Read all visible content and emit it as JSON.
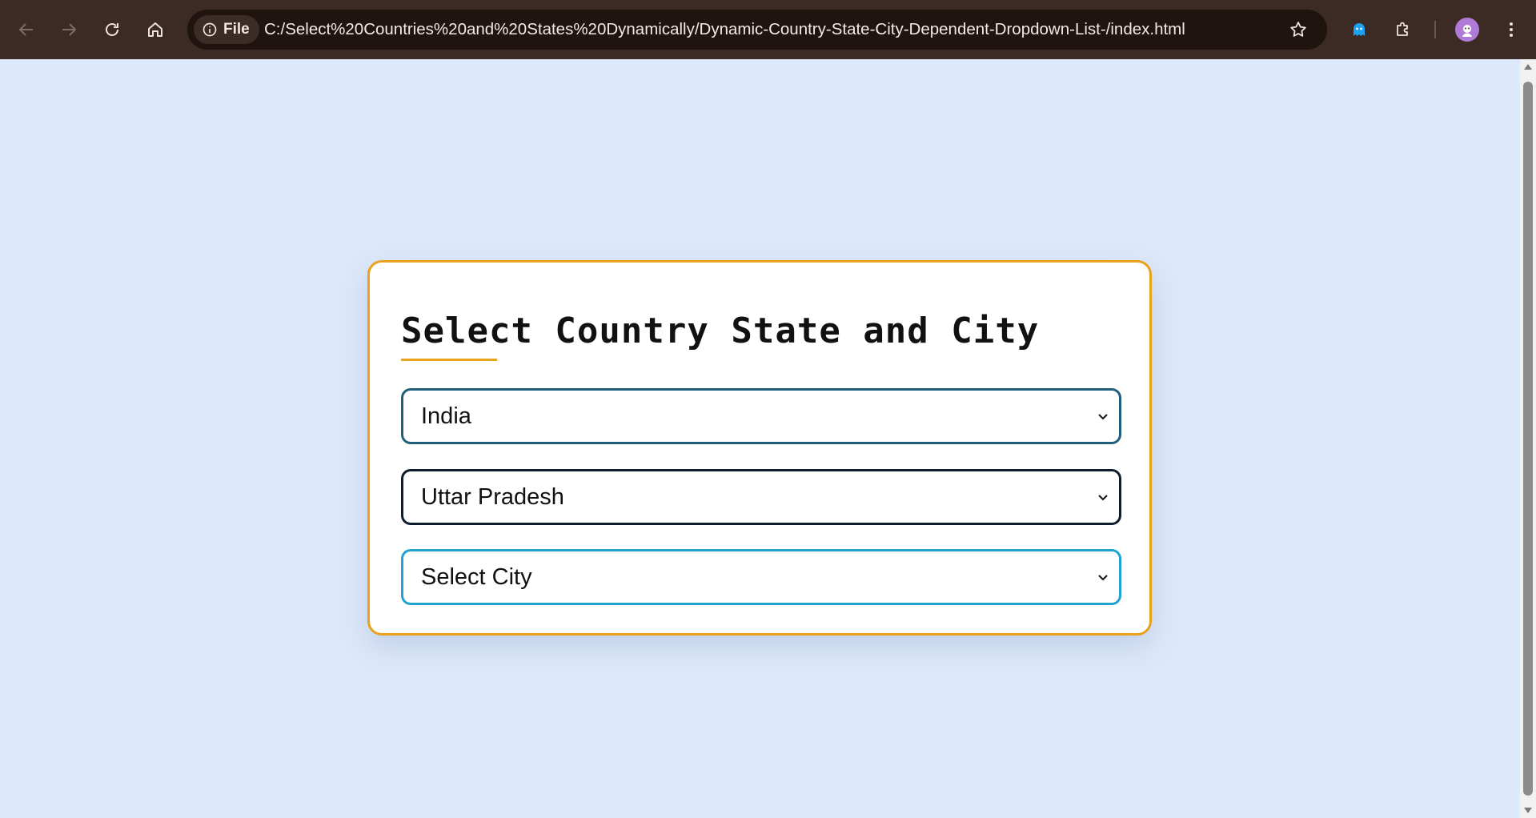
{
  "browser": {
    "site_chip_label": "File",
    "url": "C:/Select%20Countries%20and%20States%20Dynamically/Dynamic-Country-State-City-Dependent-Dropdown-List-/index.html"
  },
  "page": {
    "title": "Select Country State and City",
    "country_select": {
      "value": "India"
    },
    "state_select": {
      "value": "Uttar Pradesh"
    },
    "city_select": {
      "value": "Select City"
    }
  },
  "colors": {
    "toolbar": "#3c2a24",
    "page_background": "#dde9fa",
    "card_border": "#e8a21c",
    "country_border": "#1f5f7d",
    "state_border": "#0f1c2e",
    "city_border": "#20a3cf"
  },
  "icons": {
    "toolbar": [
      "back-arrow-icon",
      "forward-arrow-icon",
      "reload-icon",
      "home-icon",
      "info-icon",
      "star-icon",
      "ghost-extension-icon",
      "puzzle-extensions-icon",
      "profile-avatar-icon",
      "kebab-menu-icon"
    ],
    "dropdown": "chevron-down-icon"
  }
}
